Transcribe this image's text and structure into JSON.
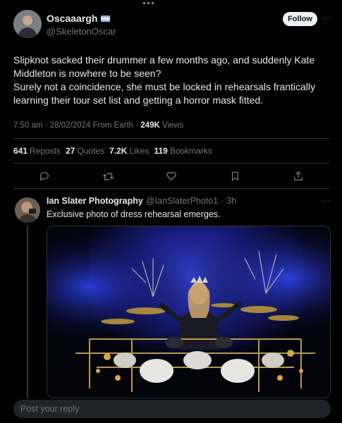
{
  "tweet": {
    "author_name": "Oscaaargh",
    "author_handle": "@SkeletonOscar",
    "follow_label": "Follow",
    "text_lines": [
      "Slipknot sacked their drummer a few months ago, and suddenly Kate Middleton is nowhere to be seen?",
      "Surely not a coincidence, she must be locked in rehearsals frantically learning their tour set list and getting a horror mask fitted."
    ],
    "time": "7:50 am",
    "date": "28/02/2024",
    "source": "From Earth",
    "views_count": "249K",
    "views_label": "Views",
    "stats": [
      {
        "count": "641",
        "label": "Reposts"
      },
      {
        "count": "27",
        "label": "Quotes"
      },
      {
        "count": "7.2K",
        "label": "Likes"
      },
      {
        "count": "119",
        "label": "Bookmarks"
      }
    ],
    "actions": [
      "reply-icon",
      "repost-icon",
      "like-icon",
      "bookmark-icon",
      "share-icon"
    ]
  },
  "reply": {
    "author_name": "Ian Slater Photography",
    "author_handle": "@IanSlaterPhoto1",
    "age": "3h",
    "text": "Exclusive photo of dress rehearsal emerges."
  },
  "composer": {
    "placeholder": "Post your reply"
  },
  "colors": {
    "background": "#000000",
    "text": "#e7e9ea",
    "secondary": "#71767b",
    "divider": "#2f3336",
    "stage_blue": "#2a35c8"
  }
}
